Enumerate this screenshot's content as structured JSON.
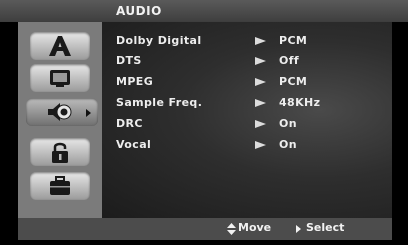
{
  "menu": {
    "title": "AUDIO",
    "rows": [
      {
        "label": "Dolby Digital",
        "value": "PCM"
      },
      {
        "label": "DTS",
        "value": "Off"
      },
      {
        "label": "MPEG",
        "value": "PCM"
      },
      {
        "label": "Sample Freq.",
        "value": "48KHz"
      },
      {
        "label": "DRC",
        "value": "On"
      },
      {
        "label": "Vocal",
        "value": "On"
      }
    ]
  },
  "tabs": [
    {
      "icon": "language-A-icon"
    },
    {
      "icon": "display-icon"
    },
    {
      "icon": "audio-speaker-icon"
    },
    {
      "icon": "lock-icon"
    },
    {
      "icon": "briefcase-icon"
    }
  ],
  "footer": {
    "move_label": "Move",
    "select_label": "Select"
  }
}
